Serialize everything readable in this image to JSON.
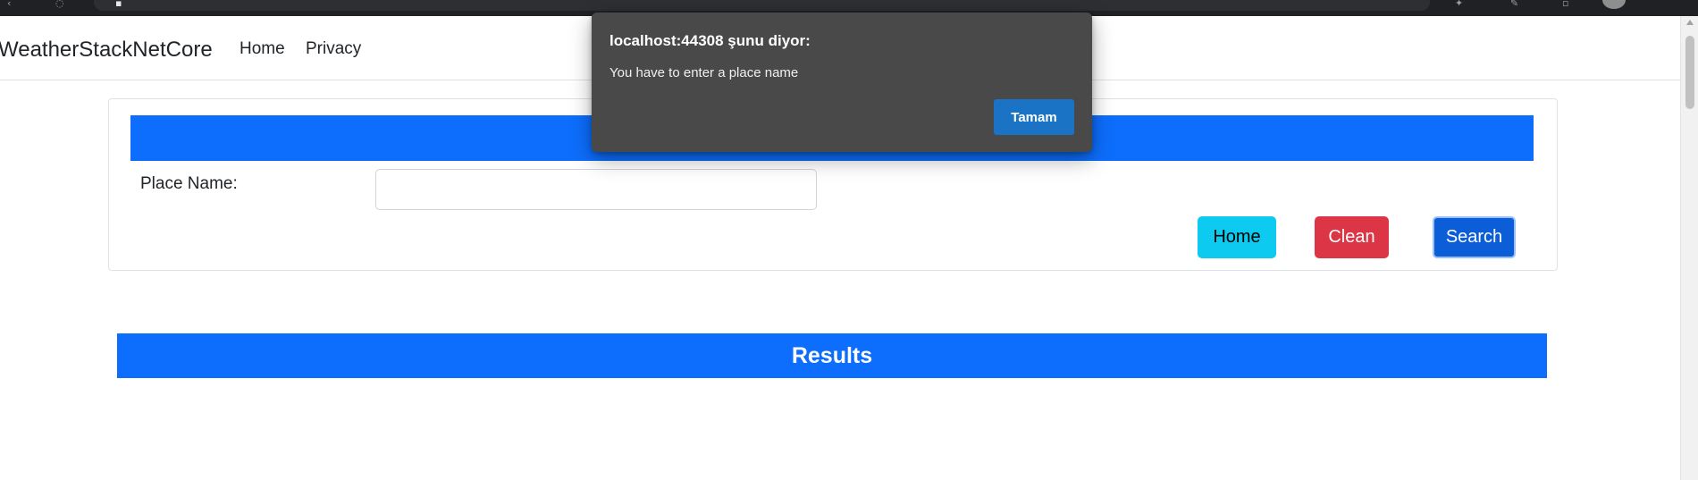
{
  "navbar": {
    "brand": "WeatherStackNetCore",
    "links": [
      "Home",
      "Privacy"
    ]
  },
  "search_card": {
    "place_label": "Place Name:",
    "place_value": "",
    "place_placeholder": "",
    "buttons": {
      "home": "Home",
      "clean": "Clean",
      "search": "Search"
    }
  },
  "results": {
    "title": "Results"
  },
  "alert": {
    "title": "localhost:44308 şunu diyor:",
    "message": "You have to enter a place name",
    "ok_label": "Tamam"
  },
  "colors": {
    "primary": "#0d6efd",
    "info": "#0dcaf0",
    "danger": "#dc3545",
    "dialog_bg": "#494949",
    "dialog_button": "#1a73c4"
  },
  "icons": [
    "browser-back-icon",
    "browser-info-icon",
    "browser-tab-icon",
    "extension-icon",
    "profile-avatar-icon"
  ]
}
